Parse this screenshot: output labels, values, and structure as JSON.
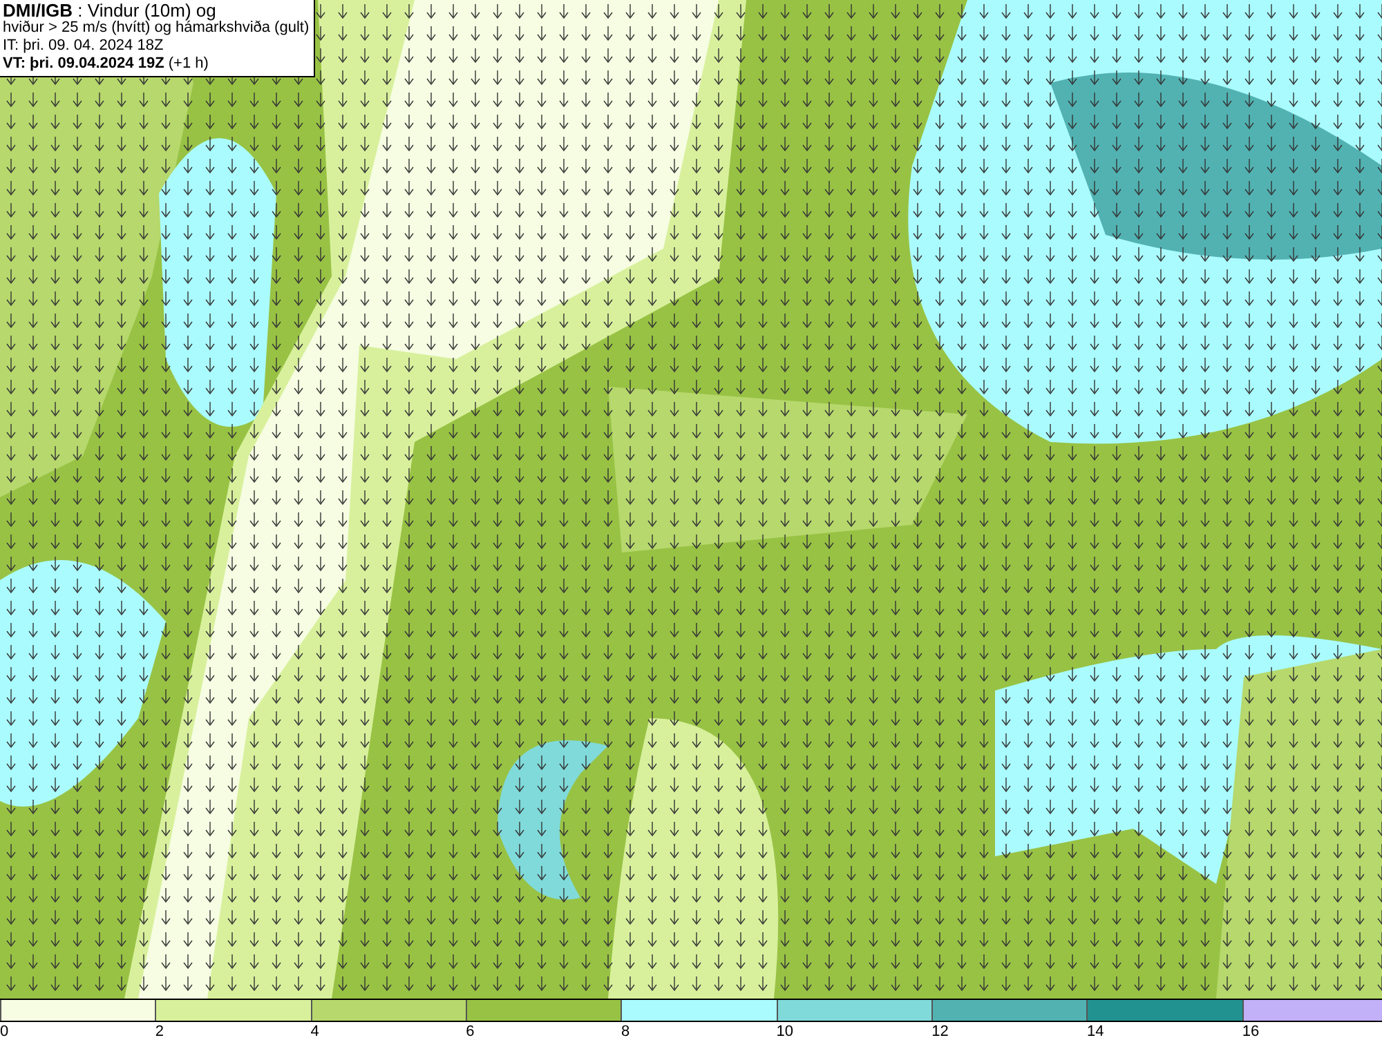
{
  "header": {
    "lines": [
      "**DMI/IGB** : Vindur (10m) og",
      "hviður > 25 m/s (hvítt) og hámarkshviða (gult)",
      "IT: þri. 09. 04. 2024 18Z",
      "**VT: þri. 09.04.2024 19Z** (+1 h)"
    ]
  },
  "legend": {
    "bins": [
      {
        "color": "#f6fde2"
      },
      {
        "color": "#d8f09c"
      },
      {
        "color": "#b6d86c"
      },
      {
        "color": "#98c244"
      },
      {
        "color": "#aafbfd"
      },
      {
        "color": "#80dada"
      },
      {
        "color": "#52b2b2"
      },
      {
        "color": "#229290"
      },
      {
        "color": "#c2b0f8"
      }
    ],
    "ticks": [
      "0",
      "2",
      "4",
      "6",
      "8",
      "10",
      "12",
      "14",
      "16"
    ]
  }
}
